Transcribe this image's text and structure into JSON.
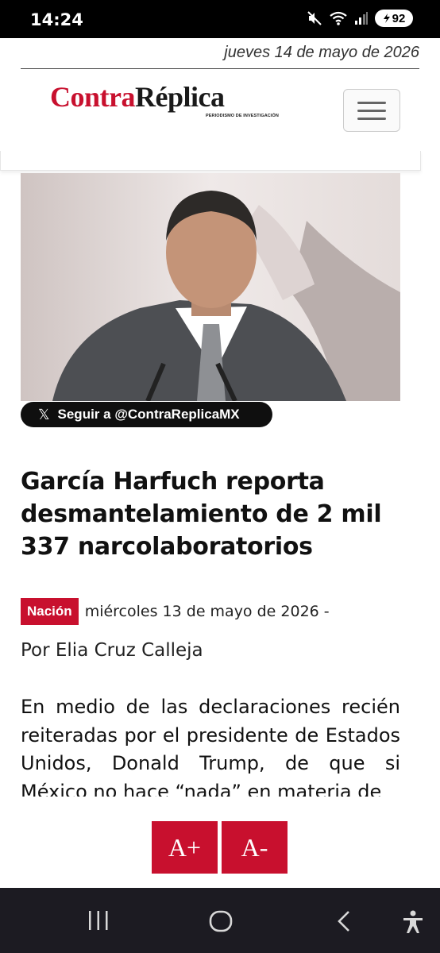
{
  "status_bar": {
    "time": "14:24",
    "battery": "92",
    "icons": [
      "mute-icon",
      "wifi-icon",
      "signal-icon",
      "battery-icon"
    ]
  },
  "site": {
    "date": "jueves 14 de mayo de 2026",
    "logo_part1": "Contra",
    "logo_part2": "Réplica",
    "tagline": "PERIODISMO DE INVESTIGACIÓN",
    "brand_color": "#c8102e"
  },
  "follow": {
    "icon": "x-logo-icon",
    "label": "Seguir a @ContraReplicaMX"
  },
  "article": {
    "headline": "García Harfuch reporta desmantelamiento de 2 mil 337 narcolaboratorios",
    "category": "Nación",
    "date": "miércoles 13 de mayo de 2026 -",
    "byline": "Por Elia Cruz Calleja",
    "body": "En medio de las declaraciones recién reiteradas por el presidente de Estados Unidos, Donald Trump, de que si México no hace “nada” en materia de"
  },
  "font_controls": {
    "increase": "A+",
    "decrease": "A-"
  },
  "nav_bar": [
    "recent-apps-icon",
    "home-icon",
    "back-icon",
    "accessibility-icon"
  ]
}
